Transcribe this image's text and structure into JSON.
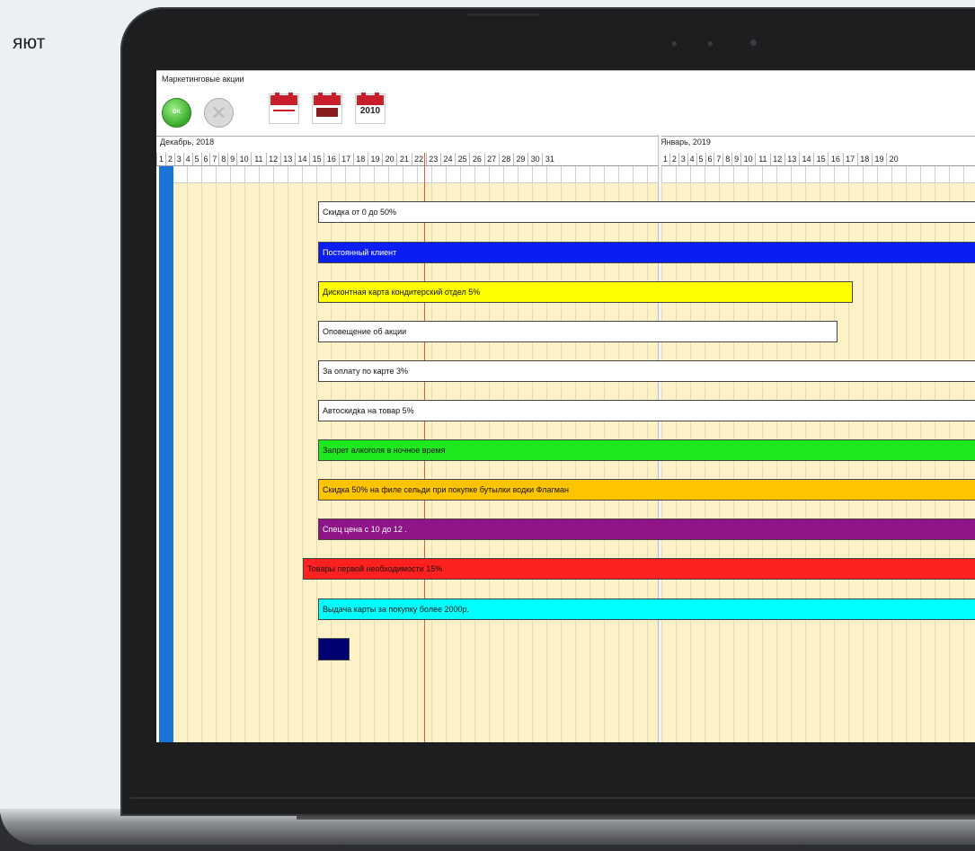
{
  "page": {
    "partial_text": "яют"
  },
  "app": {
    "window_title": "Маркетинговые акции",
    "toolbar": {
      "ok_label": "OK",
      "cancel_symbol": "✕",
      "calendar_year": "2010",
      "buttons": [
        "accept-icon",
        "cancel-icon",
        "calendar-week-icon",
        "calendar-month-icon",
        "calendar-year-icon"
      ]
    },
    "timeline": {
      "months": [
        {
          "label": "Декабрь, 2018"
        },
        {
          "label": "Январь, 2019"
        }
      ],
      "dec_days": [
        "1",
        "2",
        "3",
        "4",
        "5",
        "6",
        "7",
        "8",
        "9",
        "10",
        "11",
        "12",
        "13",
        "14",
        "15",
        "16",
        "17",
        "18",
        "19",
        "20",
        "21",
        "22",
        "23",
        "24",
        "25",
        "26",
        "27",
        "28",
        "29",
        "30",
        "31"
      ],
      "jan_days": [
        "1",
        "2",
        "3",
        "4",
        "5",
        "6",
        "7",
        "8",
        "9",
        "10",
        "11",
        "12",
        "13",
        "14",
        "15",
        "16",
        "17",
        "18",
        "19",
        "20"
      ]
    },
    "bars": [
      {
        "label": "Скидка от 0 до 50%",
        "color": "#ffffff",
        "text_color": "#111111"
      },
      {
        "label": "Постоянный клиент",
        "color": "#0a1ef2",
        "text_color": "#ffffff"
      },
      {
        "label": "Дисконтная карта кондитерский отдел 5%",
        "color": "#ffff00",
        "text_color": "#111111"
      },
      {
        "label": "Оповещение об акции",
        "color": "#ffffff",
        "text_color": "#111111"
      },
      {
        "label": "За оплату по карте 3%",
        "color": "#ffffff",
        "text_color": "#111111"
      },
      {
        "label": "Автоскидка на товар 5%",
        "color": "#ffffff",
        "text_color": "#111111"
      },
      {
        "label": "Запрет алкоголя в ночное время",
        "color": "#1ee81e",
        "text_color": "#111111"
      },
      {
        "label": "Скидка 50% на филе сельди при покупке бутылки водки Флагман",
        "color": "#ffc400",
        "text_color": "#111111"
      },
      {
        "label": "Спец цена с 10 до 12 .",
        "color": "#8e1488",
        "text_color": "#ffffff"
      },
      {
        "label": "Товары первой необходимости 15%",
        "color": "#ff2020",
        "text_color": "#111111"
      },
      {
        "label": "Выдача карты за покупку более 2000р.",
        "color": "#00ffff",
        "text_color": "#111111"
      },
      {
        "label": "",
        "color": "#000070",
        "text_color": "#ffffff"
      }
    ]
  }
}
